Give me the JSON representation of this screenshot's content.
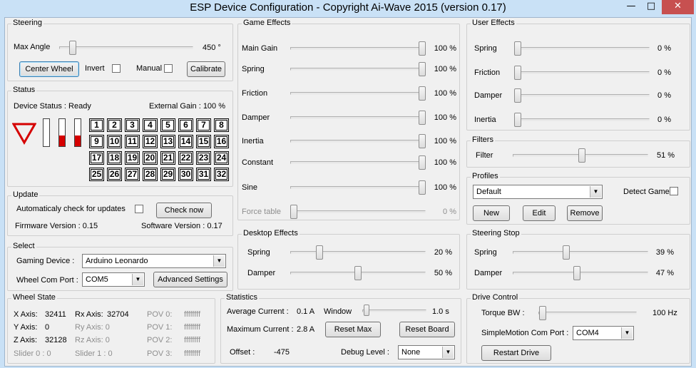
{
  "window": {
    "title": "ESP Device Configuration - Copyright Ai-Wave 2015 (version 0.17)",
    "min": "—",
    "max": "□",
    "close": "✕"
  },
  "steering": {
    "group": "Steering",
    "max_angle_label": "Max Angle",
    "max_angle_value": "450 °",
    "max_angle_level": 0.08,
    "center_wheel": "Center Wheel",
    "invert": "Invert",
    "manual": "Manual",
    "calibrate": "Calibrate"
  },
  "status": {
    "group": "Status",
    "device_status": "Device Status : Ready",
    "external_gain": "External Gain : 100 %",
    "triangle_icon": "warning-triangle",
    "bars": [
      0,
      0.4,
      0.4
    ],
    "buttons": [
      "1",
      "2",
      "3",
      "4",
      "5",
      "6",
      "7",
      "8",
      "9",
      "10",
      "11",
      "12",
      "13",
      "14",
      "15",
      "16",
      "17",
      "18",
      "19",
      "20",
      "21",
      "22",
      "23",
      "24",
      "25",
      "26",
      "27",
      "28",
      "29",
      "30",
      "31",
      "32"
    ]
  },
  "update": {
    "group": "Update",
    "auto_check": "Automaticaly check for updates",
    "check_now": "Check now",
    "firmware": "Firmware Version : 0.15",
    "software": "Software Version :  0.17"
  },
  "select": {
    "group": "Select",
    "gaming_device_label": "Gaming Device :",
    "gaming_device_value": "Arduino Leonardo",
    "com_port_label": "Wheel Com Port :",
    "com_port_value": "COM5",
    "advanced": "Advanced Settings"
  },
  "wheel_state": {
    "group": "Wheel State",
    "x_label": "X Axis:",
    "x_value": "32411",
    "y_label": "Y Axis:",
    "y_value": "0",
    "z_label": "Z Axis:",
    "z_value": "32128",
    "slider0": "Slider 0 :  0",
    "rx_label": "Rx Axis:",
    "rx_value": "32704",
    "ry": "Ry Axis:  0",
    "rz": "Rz Axis:  0",
    "slider1": "Slider 1 :  0",
    "pov0": "POV 0:",
    "pov0_value": "ffffffff",
    "pov1": "POV 1:",
    "pov1_value": "ffffffff",
    "pov2": "POV 2:",
    "pov2_value": "ffffffff",
    "pov3": "POV 3:",
    "pov3_value": "ffffffff"
  },
  "game_effects": {
    "group": "Game Effects",
    "items": [
      {
        "label": "Main Gain",
        "value": "100 %",
        "level": 1
      },
      {
        "label": "Spring",
        "value": "100 %",
        "level": 1
      },
      {
        "label": "Friction",
        "value": "100 %",
        "level": 1
      },
      {
        "label": "Damper",
        "value": "100 %",
        "level": 1
      },
      {
        "label": "Inertia",
        "value": "100 %",
        "level": 1
      },
      {
        "label": "Constant",
        "value": "100 %",
        "level": 1
      },
      {
        "label": "Sine",
        "value": "100 %",
        "level": 1
      },
      {
        "label": "Force table",
        "value": "0 %",
        "level": 0
      }
    ]
  },
  "desktop_effects": {
    "group": "Desktop Effects",
    "items": [
      {
        "label": "Spring",
        "value": "20 %",
        "level": 0.2
      },
      {
        "label": "Damper",
        "value": "50 %",
        "level": 0.5
      }
    ]
  },
  "statistics": {
    "group": "Statistics",
    "avg_label": "Average Current :",
    "avg_value": "0.1 A",
    "window_label": "Window",
    "window_value": "1.0 s",
    "window_level": 0.02,
    "max_label": "Maximum Current :",
    "max_value": "2.8 A",
    "reset_max": "Reset Max",
    "reset_board": "Reset Board",
    "offset_label": "Offset :",
    "offset_value": "-475",
    "debug_label": "Debug Level :",
    "debug_value": "None"
  },
  "user_effects": {
    "group": "User Effects",
    "items": [
      {
        "label": "Spring",
        "value": "0 %",
        "level": 0
      },
      {
        "label": "Friction",
        "value": "0 %",
        "level": 0
      },
      {
        "label": "Damper",
        "value": "0 %",
        "level": 0
      },
      {
        "label": "Inertia",
        "value": "0 %",
        "level": 0
      }
    ]
  },
  "filters": {
    "group": "Filters",
    "filter_label": "Filter",
    "filter_value": "51 %",
    "filter_level": 0.51
  },
  "profiles": {
    "group": "Profiles",
    "selected": "Default",
    "detect_game": "Detect Game",
    "new": "New",
    "edit": "Edit",
    "remove": "Remove"
  },
  "steering_stop": {
    "group": "Steering Stop",
    "items": [
      {
        "label": "Spring",
        "value": "39 %",
        "level": 0.39
      },
      {
        "label": "Damper",
        "value": "47 %",
        "level": 0.47
      }
    ]
  },
  "drive_control": {
    "group": "Drive Control",
    "torque_label": "Torque BW :",
    "torque_value": "100 Hz",
    "torque_level": 0.01,
    "sm_label": "SimpleMotion Com Port :",
    "sm_value": "COM4",
    "restart": "Restart Drive"
  }
}
